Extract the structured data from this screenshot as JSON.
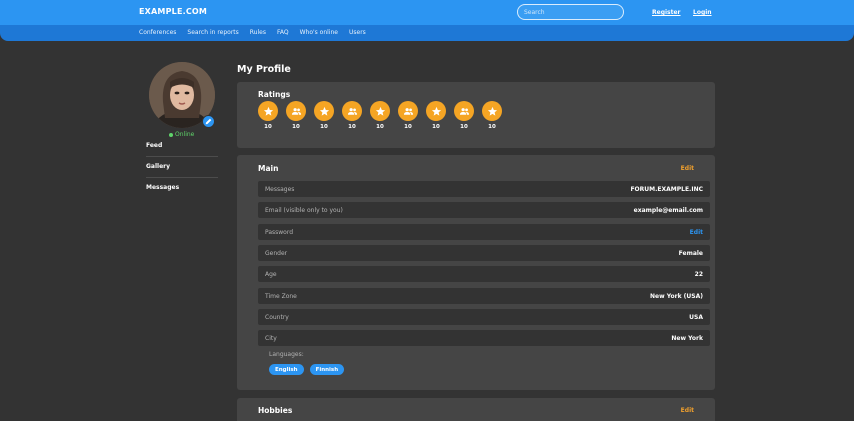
{
  "header": {
    "logo": "EXAMPLE.COM",
    "search_placeholder": "Search",
    "register": "Register",
    "login": "Login"
  },
  "nav": {
    "items": [
      "Conferences",
      "Search in reports",
      "Rules",
      "FAQ",
      "Who's online",
      "Users"
    ]
  },
  "profile": {
    "status": "Online",
    "menu": [
      "Feed",
      "Gallery",
      "Messages"
    ]
  },
  "page": {
    "title": "My Profile"
  },
  "ratings": {
    "title": "Ratings",
    "badges": [
      {
        "icon": "star-icon",
        "value": "10"
      },
      {
        "icon": "users-icon",
        "value": "10"
      },
      {
        "icon": "star-icon",
        "value": "10"
      },
      {
        "icon": "users-icon",
        "value": "10"
      },
      {
        "icon": "star-icon",
        "value": "10"
      },
      {
        "icon": "users-icon",
        "value": "10"
      },
      {
        "icon": "star-icon",
        "value": "10"
      },
      {
        "icon": "users-icon",
        "value": "10"
      },
      {
        "icon": "star-icon",
        "value": "10"
      }
    ]
  },
  "main": {
    "title": "Main",
    "edit": "Edit",
    "rows": [
      {
        "label": "Messages",
        "value": "FORUM.EXAMPLE.INC"
      },
      {
        "label": "Email (visible only to you)",
        "value": "example@email.com"
      },
      {
        "label": "Password",
        "value": "Edit"
      },
      {
        "label": "Gender",
        "value": "Female"
      },
      {
        "label": "Age",
        "value": "22"
      },
      {
        "label": "Time Zone",
        "value": "New York (USA)"
      },
      {
        "label": "Country",
        "value": "USA"
      },
      {
        "label": "City",
        "value": "New York"
      }
    ],
    "languages_label": "Languages:",
    "languages": [
      "English",
      "Finnish"
    ]
  },
  "hobbies": {
    "title": "Hobbies",
    "edit": "Edit"
  },
  "colors": {
    "accent": "#2c95f2",
    "badge": "#f5a524",
    "edit": "#f0a02d",
    "online": "#5fd36a"
  }
}
